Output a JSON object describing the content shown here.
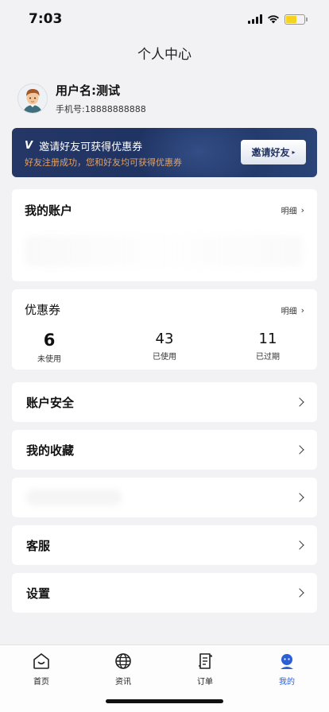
{
  "status_bar": {
    "time": "7:03"
  },
  "page": {
    "title": "个人中心"
  },
  "profile": {
    "username": "用户名:测试",
    "phone": "手机号:18888888888"
  },
  "invite": {
    "logo": "V",
    "title": "邀请好友可获得优惠券",
    "subtitle": "好友注册成功，您和好友均可获得优惠券",
    "button_label": "邀请好友",
    "button_arrow": "▸"
  },
  "account": {
    "title": "我的账户",
    "detail_label": "明细",
    "chevron": "›"
  },
  "coupons": {
    "title": "优惠券",
    "detail_label": "明细",
    "chevron": "›",
    "stats": [
      {
        "value": "6",
        "label": "未使用"
      },
      {
        "value": "43",
        "label": "已使用"
      },
      {
        "value": "11",
        "label": "已过期"
      }
    ]
  },
  "menu": {
    "items": [
      {
        "label": "账户安全"
      },
      {
        "label": "我的收藏"
      },
      {
        "label": ""
      },
      {
        "label": "客服"
      },
      {
        "label": "设置"
      }
    ]
  },
  "tab_bar": {
    "tabs": [
      {
        "label": "首页",
        "icon": "home-icon"
      },
      {
        "label": "资讯",
        "icon": "globe-icon"
      },
      {
        "label": "订单",
        "icon": "order-icon"
      },
      {
        "label": "我的",
        "icon": "profile-icon"
      }
    ],
    "active_index": 3
  },
  "colors": {
    "accent": "#2a5fd8",
    "banner_bg": "#243766",
    "banner_sub": "#e6a25f",
    "page_bg": "#f2f2f4"
  }
}
